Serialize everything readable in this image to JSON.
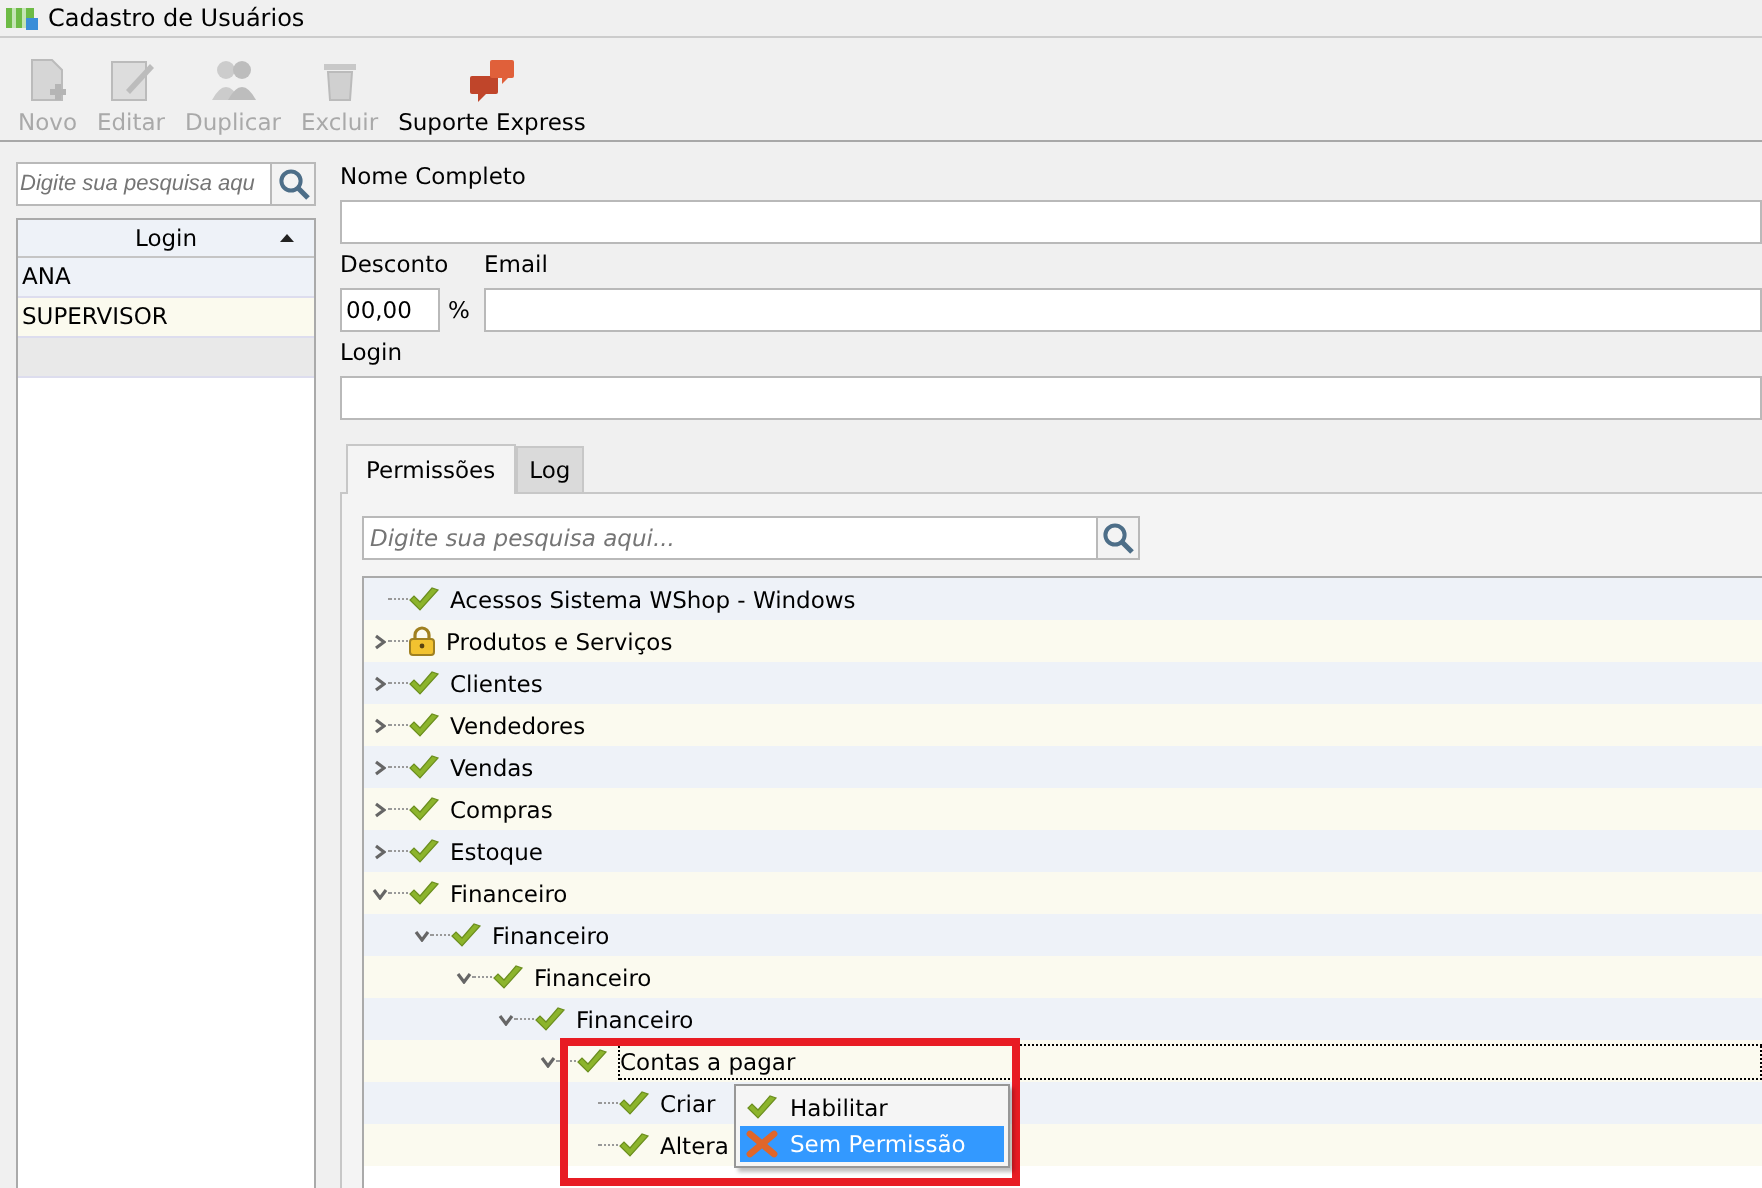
{
  "window": {
    "title": "Cadastro de Usuários"
  },
  "toolbar": [
    {
      "label": "Novo",
      "kind": "new",
      "disabled": true
    },
    {
      "label": "Editar",
      "kind": "edit",
      "disabled": true
    },
    {
      "label": "Duplicar",
      "kind": "duplicate",
      "disabled": true
    },
    {
      "label": "Excluir",
      "kind": "delete",
      "disabled": true
    },
    {
      "label": "Suporte Express",
      "kind": "support",
      "disabled": false
    }
  ],
  "user_list": {
    "search": {
      "placeholder": "Digite sua pesquisa aqu"
    },
    "column": "Login",
    "rows": [
      {
        "login": "ANA",
        "selected": false
      },
      {
        "login": "SUPERVISOR",
        "selected": false
      }
    ]
  },
  "form": {
    "name_label": "Nome Completo",
    "discount_label": "Desconto",
    "discount_value": "00,00",
    "percent": "%",
    "email_label": "Email",
    "login_label": "Login"
  },
  "tabs": [
    {
      "label": "Permissões",
      "selected": true
    },
    {
      "label": "Log",
      "selected": false
    }
  ],
  "permissions": {
    "search": {
      "placeholder": "Digite sua pesquisa aqui..."
    },
    "tree": [
      {
        "label": "Acessos Sistema WShop - Windows",
        "kind": "allowed"
      },
      {
        "label": "Produtos e Serviços",
        "kind": "locked",
        "expanded": false
      },
      {
        "label": "Clientes",
        "kind": "allowed",
        "expanded": false
      },
      {
        "label": "Vendedores",
        "kind": "allowed",
        "expanded": false
      },
      {
        "label": "Vendas",
        "kind": "allowed",
        "expanded": false
      },
      {
        "label": "Compras",
        "kind": "allowed",
        "expanded": false
      },
      {
        "label": "Estoque",
        "kind": "allowed",
        "expanded": false
      },
      {
        "label": "Financeiro",
        "kind": "allowed",
        "expanded": true,
        "children": [
          {
            "label": "Financeiro",
            "kind": "allowed",
            "expanded": true,
            "children": [
              {
                "label": "Financeiro",
                "kind": "allowed",
                "expanded": true,
                "children": [
                  {
                    "label": "Financeiro",
                    "kind": "allowed",
                    "expanded": true,
                    "children": [
                      {
                        "label": "Contas a pagar",
                        "kind": "allowed",
                        "expanded": true,
                        "selected": true,
                        "children": [
                          {
                            "label": "Criar",
                            "kind": "allowed",
                            "selected": false
                          },
                          {
                            "label": "Altera",
                            "kind": "allowed",
                            "selected": false
                          }
                        ]
                      }
                    ]
                  }
                ]
              }
            ]
          }
        ]
      }
    ]
  },
  "context_menu": [
    {
      "label": "Habilitar",
      "kind": "allowed",
      "selected": false
    },
    {
      "label": "Sem Permissão",
      "kind": "denied",
      "selected": true
    }
  ]
}
